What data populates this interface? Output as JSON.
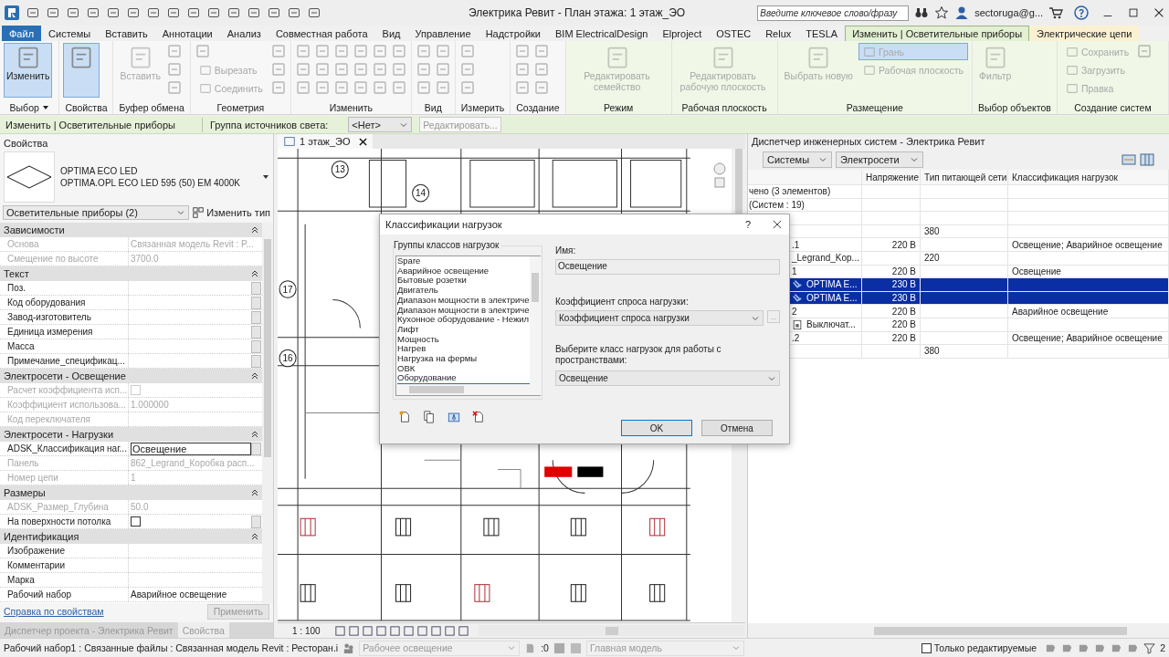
{
  "title_bar": {
    "title": "Электрика Ревит - План этажа: 1 этаж_ЭО",
    "search": {
      "placeholder": "Введите ключевое слово/фразу"
    },
    "user": "sectoruga@g..."
  },
  "menu_tabs": [
    {
      "label": "Файл",
      "kind": "file",
      "selected": false
    },
    {
      "label": "Системы",
      "kind": "normal",
      "selected": false
    },
    {
      "label": "Вставить",
      "kind": "normal",
      "selected": false
    },
    {
      "label": "Аннотации",
      "kind": "normal",
      "selected": false
    },
    {
      "label": "Анализ",
      "kind": "normal",
      "selected": false
    },
    {
      "label": "Совместная работа",
      "kind": "normal",
      "selected": false
    },
    {
      "label": "Вид",
      "kind": "normal",
      "selected": false
    },
    {
      "label": "Управление",
      "kind": "normal",
      "selected": false
    },
    {
      "label": "Надстройки",
      "kind": "normal",
      "selected": false
    },
    {
      "label": "BIM ElectricalDesign",
      "kind": "normal",
      "selected": false
    },
    {
      "label": "Elproject",
      "kind": "normal",
      "selected": false
    },
    {
      "label": "OSTEC",
      "kind": "normal",
      "selected": false
    },
    {
      "label": "Relux",
      "kind": "normal",
      "selected": false
    },
    {
      "label": "TESLA",
      "kind": "normal",
      "selected": false
    },
    {
      "label": "Изменить | Осветительные приборы",
      "kind": "context",
      "selected": true,
      "color": "#e3f0d3"
    },
    {
      "label": "Электрические цепи",
      "kind": "context",
      "selected": false,
      "color": "#fbf1d2"
    }
  ],
  "ribbon": {
    "panels": [
      {
        "label": "Выбор",
        "has_menu": true,
        "context": false,
        "items": [
          {
            "kind": "large",
            "label": "Изменить",
            "selected": true,
            "disabled": false
          }
        ]
      },
      {
        "label": "Свойства",
        "has_menu": false,
        "context": false,
        "items": [
          {
            "kind": "large",
            "selected": true,
            "disabled": false
          }
        ]
      },
      {
        "label": "Буфер обмена",
        "has_menu": false,
        "context": false,
        "items": [
          {
            "kind": "large",
            "label": "Вставить",
            "selected": false,
            "disabled": true
          },
          {
            "kind": "icon",
            "selected": false,
            "disabled": true
          },
          {
            "kind": "icon",
            "selected": false,
            "disabled": true
          },
          {
            "kind": "icon",
            "selected": false,
            "disabled": true
          }
        ]
      },
      {
        "label": "Геометрия",
        "has_menu": false,
        "context": false,
        "items": [
          {
            "kind": "icon",
            "selected": false,
            "disabled": true
          },
          {
            "kind": "small",
            "label": "Вырезать",
            "selected": false,
            "disabled": true
          },
          {
            "kind": "small",
            "label": "Соединить",
            "selected": false,
            "disabled": true
          },
          {
            "kind": "icon",
            "selected": false,
            "disabled": true
          },
          {
            "kind": "icon",
            "selected": false,
            "disabled": true
          },
          {
            "kind": "icon",
            "selected": false,
            "disabled": true
          }
        ]
      },
      {
        "label": "Изменить",
        "has_menu": false,
        "context": false,
        "items": [
          {
            "kind": "icon",
            "selected": false,
            "disabled": true
          },
          {
            "kind": "icon",
            "selected": false,
            "disabled": true
          },
          {
            "kind": "icon",
            "selected": false,
            "disabled": true
          },
          {
            "kind": "icon",
            "selected": false,
            "disabled": true
          },
          {
            "kind": "icon",
            "selected": false,
            "disabled": true
          },
          {
            "kind": "icon",
            "selected": false,
            "disabled": true
          },
          {
            "kind": "icon",
            "selected": false,
            "disabled": true
          },
          {
            "kind": "icon",
            "selected": false,
            "disabled": true
          },
          {
            "kind": "icon",
            "selected": false,
            "disabled": true
          },
          {
            "kind": "icon",
            "selected": false,
            "disabled": true
          },
          {
            "kind": "icon",
            "selected": false,
            "disabled": true
          },
          {
            "kind": "icon",
            "selected": false,
            "disabled": true
          },
          {
            "kind": "icon",
            "selected": false,
            "disabled": true
          },
          {
            "kind": "icon",
            "selected": false,
            "disabled": true
          },
          {
            "kind": "icon",
            "selected": false,
            "disabled": true
          },
          {
            "kind": "icon",
            "selected": false,
            "disabled": true
          },
          {
            "kind": "icon",
            "selected": false,
            "disabled": true
          },
          {
            "kind": "icon",
            "selected": false,
            "disabled": true
          }
        ]
      },
      {
        "label": "Вид",
        "has_menu": false,
        "context": false,
        "items": [
          {
            "kind": "icon",
            "selected": false,
            "disabled": true
          },
          {
            "kind": "icon",
            "selected": false,
            "disabled": true
          },
          {
            "kind": "icon",
            "selected": false,
            "disabled": true
          },
          {
            "kind": "icon",
            "selected": false,
            "disabled": true
          },
          {
            "kind": "icon",
            "selected": false,
            "disabled": true
          },
          {
            "kind": "icon",
            "selected": false,
            "disabled": true
          }
        ]
      },
      {
        "label": "Измерить",
        "has_menu": false,
        "context": false,
        "items": [
          {
            "kind": "icon",
            "selected": false,
            "disabled": true
          },
          {
            "kind": "icon",
            "selected": false,
            "disabled": true
          },
          {
            "kind": "icon",
            "selected": false,
            "disabled": true
          }
        ]
      },
      {
        "label": "Создание",
        "has_menu": false,
        "context": false,
        "items": [
          {
            "kind": "icon",
            "selected": false,
            "disabled": true
          },
          {
            "kind": "icon",
            "selected": false,
            "disabled": true
          },
          {
            "kind": "icon",
            "selected": false,
            "disabled": true
          },
          {
            "kind": "icon",
            "selected": false,
            "disabled": true
          },
          {
            "kind": "icon",
            "selected": false,
            "disabled": true
          },
          {
            "kind": "icon",
            "selected": false,
            "disabled": true
          }
        ]
      },
      {
        "label": "Режим",
        "has_menu": false,
        "context": true,
        "items": [
          {
            "kind": "large",
            "label": "Редактировать семейство",
            "selected": false,
            "disabled": true
          }
        ]
      },
      {
        "label": "Рабочая плоскость",
        "has_menu": false,
        "context": true,
        "items": [
          {
            "kind": "large",
            "label": "Редактировать рабочую плоскость",
            "selected": false,
            "disabled": true
          }
        ]
      },
      {
        "label": "Размещение",
        "has_menu": false,
        "context": true,
        "items": [
          {
            "kind": "large",
            "label": "Выбрать новую",
            "selected": false,
            "disabled": true
          },
          {
            "kind": "small",
            "label": "Грань",
            "selected": true,
            "disabled": true
          },
          {
            "kind": "small",
            "label": "Рабочая плоскость",
            "selected": false,
            "disabled": true
          }
        ]
      },
      {
        "label": "Выбор объектов",
        "has_menu": false,
        "context": true,
        "items": [
          {
            "kind": "large",
            "label": "Фильтр",
            "selected": false,
            "disabled": true
          }
        ]
      },
      {
        "label": "Создание систем",
        "has_menu": false,
        "context": true,
        "items": [
          {
            "kind": "small",
            "label": "Сохранить",
            "selected": false,
            "disabled": true
          },
          {
            "kind": "small",
            "label": "Загрузить",
            "selected": false,
            "disabled": true
          },
          {
            "kind": "small",
            "label": "Правка",
            "selected": false,
            "disabled": true
          },
          {
            "kind": "icon",
            "selected": false,
            "disabled": true
          }
        ]
      }
    ]
  },
  "options_bar": {
    "context": "Изменить | Осветительные приборы",
    "group_label": "Группа источников света:",
    "group_value": "<Нет>",
    "edit_button": "Редактировать..."
  },
  "properties": {
    "title": "Свойства",
    "type_name": "OPTIMA ECO LED",
    "type_detail": "OPTIMA.OPL ECO LED 595 (50) EM 4000K",
    "category": "Осветительные приборы (2)",
    "edit_type": "Изменить тип",
    "groups": [
      {
        "label": "Зависимости",
        "rows": [
          {
            "label": "Основа",
            "value": "Связанная модель Revit : P...",
            "kind": "text",
            "disabled": true,
            "has_button": false
          },
          {
            "label": "Смещение по высоте",
            "value": "3700.0",
            "kind": "text",
            "disabled": true,
            "has_button": false
          }
        ]
      },
      {
        "label": "Текст",
        "rows": [
          {
            "label": "Поз.",
            "kind": "text",
            "disabled": false,
            "has_button": true
          },
          {
            "label": "Код оборудования",
            "kind": "text",
            "disabled": false,
            "has_button": true
          },
          {
            "label": "Завод-изготовитель",
            "kind": "text",
            "disabled": false,
            "has_button": true
          },
          {
            "label": "Единица измерения",
            "kind": "text",
            "disabled": false,
            "has_button": true
          },
          {
            "label": "Масса",
            "kind": "text",
            "disabled": false,
            "has_button": true
          },
          {
            "label": "Примечание_спецификац...",
            "kind": "text",
            "disabled": false,
            "has_button": true
          }
        ]
      },
      {
        "label": "Электросети - Освещение",
        "rows": [
          {
            "label": "Расчет коэффициента исп...",
            "kind": "checkbox",
            "checked": false,
            "disabled": true,
            "has_button": false
          },
          {
            "label": "Коэффициент использова...",
            "value": "1.000000",
            "kind": "text",
            "disabled": true,
            "has_button": false
          },
          {
            "label": "Код переключателя",
            "kind": "text",
            "disabled": true,
            "has_button": false
          }
        ]
      },
      {
        "label": "Электросети - Нагрузки",
        "rows": [
          {
            "label": "ADSK_Классификация наг...",
            "value": "Освещение",
            "kind": "edit",
            "disabled": false,
            "has_button": true
          },
          {
            "label": "Панель",
            "value": "862_Legrand_Коробка расп...",
            "kind": "text",
            "disabled": true,
            "has_button": false
          },
          {
            "label": "Номер цепи",
            "value": "1",
            "kind": "text",
            "disabled": true,
            "has_button": false
          }
        ]
      },
      {
        "label": "Размеры",
        "rows": [
          {
            "label": "ADSK_Размер_Глубина",
            "value": "50.0",
            "kind": "text",
            "disabled": true,
            "has_button": false
          },
          {
            "label": "На поверхности потолка",
            "kind": "checkbox",
            "checked": false,
            "disabled": false,
            "has_button": true
          }
        ]
      },
      {
        "label": "Идентификация",
        "rows": [
          {
            "label": "Изображение",
            "kind": "text",
            "disabled": false,
            "has_button": false
          },
          {
            "label": "Комментарии",
            "kind": "text",
            "disabled": false,
            "has_button": false
          },
          {
            "label": "Марка",
            "kind": "text",
            "disabled": false,
            "has_button": false
          },
          {
            "label": "Рабочий набор",
            "value": "Аварийное освещение",
            "kind": "text",
            "disabled": false,
            "has_button": false
          }
        ]
      }
    ],
    "help_link": "Справка по свойствам",
    "apply": "Применить",
    "bottom_tabs": [
      {
        "label": "Диспетчер проекта - Электрика Ревит",
        "selected": false
      },
      {
        "label": "Свойства",
        "selected": true
      }
    ]
  },
  "view": {
    "tab": "1 этаж_ЭО",
    "grid_bubbles": [
      "13",
      "14",
      "17",
      "16"
    ],
    "scale": "1 : 100"
  },
  "dialog": {
    "title": "Классификации нагрузок",
    "help": "?",
    "group_label": "Группы классов нагрузок",
    "items": [
      {
        "label": "Spare",
        "selected": false
      },
      {
        "label": "Аварийное освещение",
        "selected": false
      },
      {
        "label": "Бытовые розетки",
        "selected": false
      },
      {
        "label": "Двигатель",
        "selected": false
      },
      {
        "label": "Диапазон мощности в электриче",
        "selected": false
      },
      {
        "label": "Диапазон мощности в электриче",
        "selected": false
      },
      {
        "label": "Кухонное оборудование - Нежил",
        "selected": false
      },
      {
        "label": "Лифт",
        "selected": false
      },
      {
        "label": "Мощность",
        "selected": false
      },
      {
        "label": "Нагрев",
        "selected": false
      },
      {
        "label": "Нагрузка на фермы",
        "selected": false
      },
      {
        "label": "ОВК",
        "selected": false
      },
      {
        "label": "Оборудование",
        "selected": true
      }
    ],
    "name_label": "Имя:",
    "name_value": "Освещение",
    "demand_label": "Коэффициент спроса нагрузки:",
    "demand_value": "Коэффициент спроса нагрузки",
    "browse": "...",
    "space_label": "Выберите класс нагрузок для работы с пространствами:",
    "space_value": "Освещение",
    "buttons": [
      {
        "label": "OK",
        "default": true
      },
      {
        "label": "Отмена",
        "default": false
      }
    ]
  },
  "system_browser": {
    "title": "Диспетчер инженерных систем - Электрика Ревит",
    "filter_1": "Системы",
    "filter_2": "Электросети",
    "columns": [
      "Напряжение",
      "Тип питающей сети",
      "Классификация нагрузок"
    ],
    "rows": [
      {
        "kind": "summary",
        "name": "чено (3 элементов)",
        "selected": false
      },
      {
        "kind": "summary",
        "name": "(Систем : 19)",
        "selected": false
      },
      {
        "kind": "item",
        "selected": false
      },
      {
        "kind": "item",
        "network": "380",
        "selected": false
      },
      {
        "kind": "item",
        "name": ".1",
        "voltage": "220 В",
        "classification": "Освещение; Аварийное освещение",
        "selected": false
      },
      {
        "kind": "item",
        "name": "_Legrand_Kop...",
        "network": "220",
        "selected": false
      },
      {
        "kind": "item",
        "name": "1",
        "voltage": "220 В",
        "classification": "Освещение",
        "selected": false
      },
      {
        "kind": "fixture",
        "name": "OPTIMA E...",
        "voltage": "230 В",
        "selected": true
      },
      {
        "kind": "fixture",
        "name": "OPTIMA E...",
        "voltage": "230 В",
        "selected": true
      },
      {
        "kind": "item",
        "name": "2",
        "voltage": "220 В",
        "classification": "Аварийное освещение",
        "selected": false
      },
      {
        "kind": "switch",
        "name": "Выключат...",
        "voltage": "220 В",
        "selected": false
      },
      {
        "kind": "item",
        "name": ".2",
        "voltage": "220 В",
        "classification": "Освещение; Аварийное освещение",
        "selected": false
      },
      {
        "kind": "item",
        "network": "380",
        "selected": false
      }
    ]
  },
  "status_bar": {
    "text": "Рабочий набор1 : Связанные файлы : Связанная модель Revit : Ресторан.i",
    "workset": "Рабочее освещение",
    "count": ":0",
    "model": "Главная модель",
    "editable_only": {
      "label": "Только редактируемые",
      "checked": false
    },
    "filter_count": "2"
  }
}
